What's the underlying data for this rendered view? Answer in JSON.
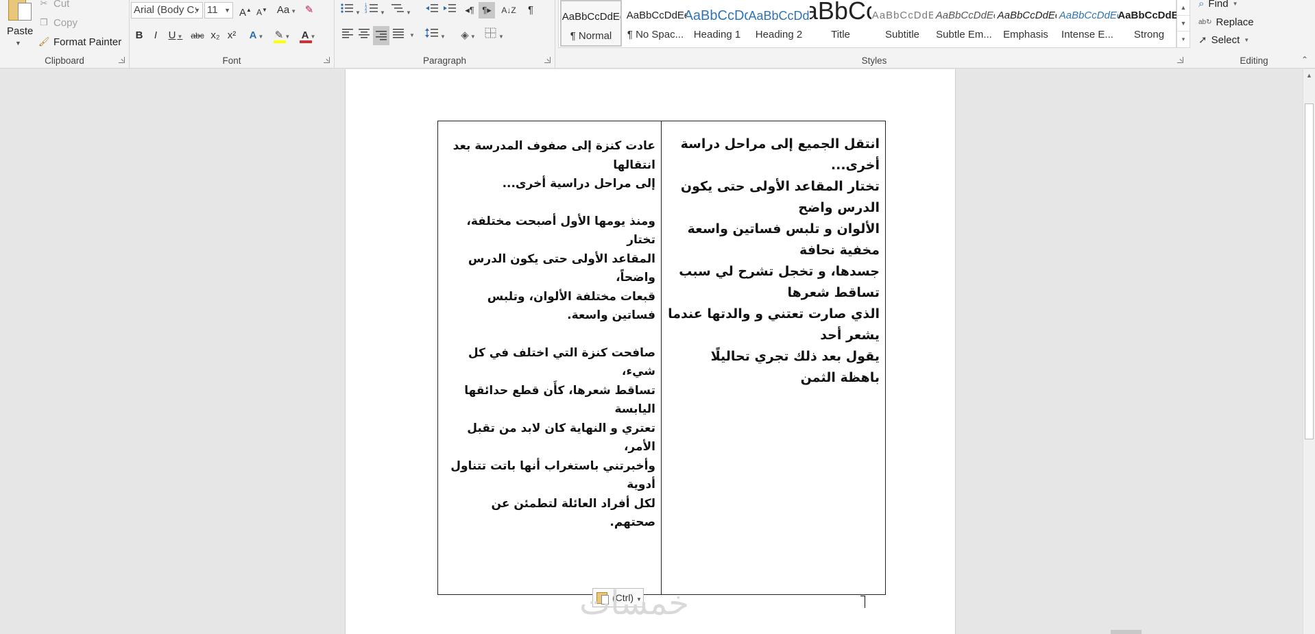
{
  "ribbon": {
    "clipboard": {
      "label": "Clipboard",
      "paste": "Paste",
      "cut": "Cut",
      "copy": "Copy",
      "format_painter": "Format Painter"
    },
    "font": {
      "label": "Font",
      "font_name": "Arial (Body C:",
      "font_size": "11",
      "grow": "A",
      "shrink": "A",
      "change_case": "Aa",
      "bold": "B",
      "italic": "I",
      "underline": "U",
      "strike": "abc",
      "subscript": "x₂",
      "superscript": "x²",
      "text_effects": "A",
      "font_color": "A",
      "highlight_color": "#ffff00",
      "font_color_value": "#d32f2f"
    },
    "paragraph": {
      "label": "Paragraph",
      "pilcrow": "¶"
    },
    "styles": {
      "label": "Styles",
      "items": [
        {
          "preview": "AaBbCcDdEe",
          "name": "¶ Normal"
        },
        {
          "preview": "AaBbCcDdEe",
          "name": "¶ No Spac..."
        },
        {
          "preview": "AaBbCcDdEe",
          "name": "Heading 1"
        },
        {
          "preview": "AaBbCcDdEe",
          "name": "Heading 2"
        },
        {
          "preview": "AaBbCcDdEe",
          "name": "Title"
        },
        {
          "preview": "AaBbCcDdEe",
          "name": "Subtitle"
        },
        {
          "preview": "AaBbCcDdEe",
          "name": "Subtle Em..."
        },
        {
          "preview": "AaBbCcDdEe",
          "name": "Emphasis"
        },
        {
          "preview": "AaBbCcDdEe",
          "name": "Intense E..."
        },
        {
          "preview": "AaBbCcDdEe",
          "name": "Strong"
        }
      ]
    },
    "editing": {
      "label": "Editing",
      "find": "Find",
      "replace": "Replace",
      "select": "Select"
    }
  },
  "document": {
    "right_cell_lines": [
      "انتقل الجميع إلى مراحل دراسة أخرى...",
      "تختار المقاعد الأولى حتى يكون الدرس واضح",
      "الألوان و تلبس فساتين واسعة مخفية نحافة",
      "جسدها، و تخجل تشرح لي سبب تساقط شعرها",
      "الذي صارت تعتني و والدتها عندما يشعر أحد",
      "يقول بعد ذلك تجري تحاليلًا باهظة الثمن"
    ],
    "left_cell": {
      "para1": [
        "عادت كنزة إلى صفوف المدرسة بعد انتقالها",
        "إلى مراحل دراسية أخرى..."
      ],
      "para2": [
        "ومنذ يومها الأول أصبحت مختلفة، تختار",
        "المقاعد الأولى حتى يكون الدرس واضحاً،",
        "قبعات مختلفة الألوان، وتلبس فساتين واسعة."
      ],
      "para3": [
        "صافحت كنزة التي اختلف في كل شيء،",
        "تساقط شعرها، كأَن قطع حدائقها اليابسة",
        "تعتري و النهاية كان لابد من تقبل الأمر،",
        "وأخبرتني باستغراب أنها باتت تتناول أدوية",
        "لكل أفراد العائلة لتطمئن عن صحتهم."
      ]
    },
    "paste_options_label": "(Ctrl)",
    "watermark": "خمسات"
  }
}
